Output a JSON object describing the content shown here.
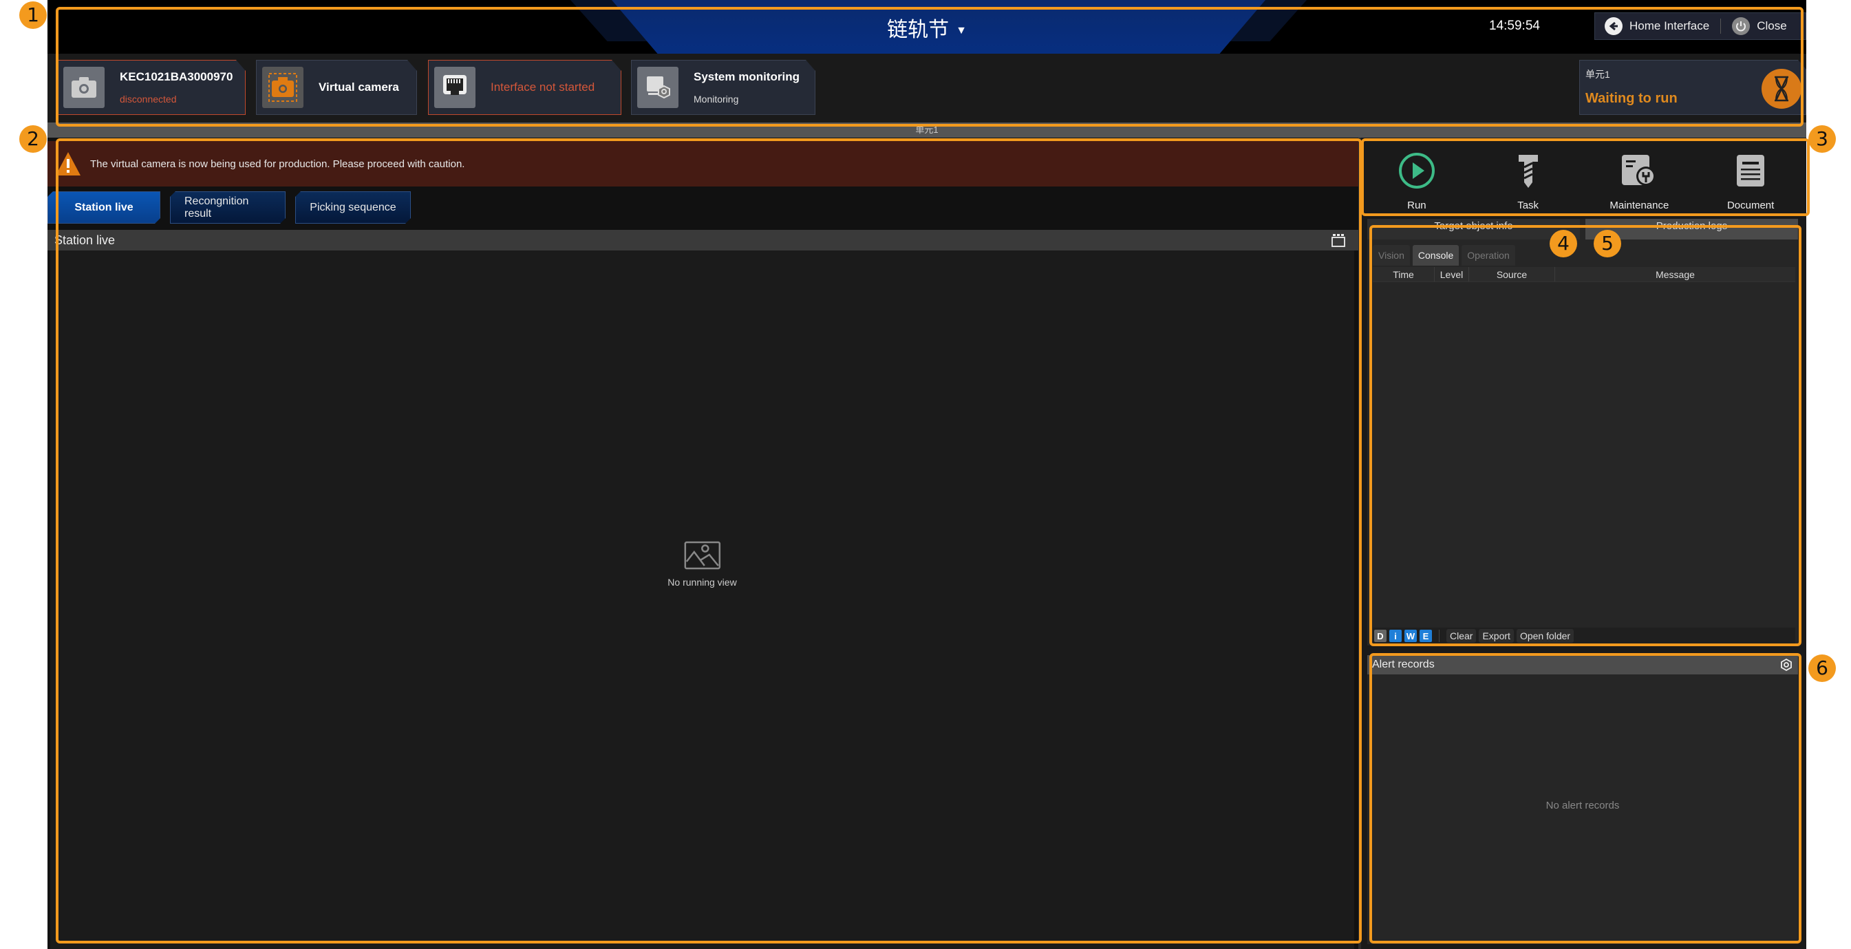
{
  "header": {
    "title": "链轨节",
    "clock": "14:59:54",
    "home_label": "Home Interface",
    "close_label": "Close"
  },
  "status_cards": [
    {
      "title": "KEC1021BA3000970",
      "subtitle": "disconnected",
      "icon": "camera-icon",
      "state": "error"
    },
    {
      "title": "Virtual camera",
      "subtitle": "",
      "icon": "virtual-camera-icon",
      "state": "normal"
    },
    {
      "title": "Interface not started",
      "subtitle": "",
      "icon": "ethernet-port-icon",
      "state": "error"
    },
    {
      "title": "System monitoring",
      "subtitle": "Monitoring",
      "icon": "system-monitor-icon",
      "state": "normal"
    }
  ],
  "unit": {
    "name": "单元1",
    "status": "Waiting to run",
    "status_color": "#e08a1e",
    "strip_label": "单元1"
  },
  "warning": {
    "message": "The virtual camera is now being used for production. Please proceed with caution."
  },
  "view_tabs": [
    {
      "label": "Station live",
      "active": true
    },
    {
      "label": "Recongnition result",
      "active": false
    },
    {
      "label": "Picking sequence",
      "active": false
    }
  ],
  "station_live": {
    "header": "Station live",
    "empty_text": "No running view"
  },
  "toolbar": [
    {
      "label": "Run",
      "icon": "play-icon"
    },
    {
      "label": "Task",
      "icon": "screw-icon"
    },
    {
      "label": "Maintenance",
      "icon": "maintenance-icon"
    },
    {
      "label": "Document",
      "icon": "document-icon"
    }
  ],
  "log_panel": {
    "tabs": [
      {
        "label": "Target object info",
        "selected": false
      },
      {
        "label": "Production logs",
        "selected": true
      }
    ],
    "sub_tabs": [
      {
        "label": "Vision",
        "selected": false
      },
      {
        "label": "Console",
        "selected": true
      },
      {
        "label": "Operation",
        "selected": false
      }
    ],
    "columns": [
      "Time",
      "Level",
      "Source",
      "Message"
    ],
    "rows": [],
    "level_filters": [
      "D",
      "i",
      "W",
      "E"
    ],
    "actions": [
      "Clear",
      "Export",
      "Open folder"
    ]
  },
  "alerts": {
    "title": "Alert records",
    "empty_text": "No alert records"
  },
  "annotations": [
    "1",
    "2",
    "3",
    "4",
    "5",
    "6"
  ],
  "colors": {
    "accent": "#f39a1e",
    "error": "#d4573a",
    "run_green": "#3dbb87",
    "tab_active": "#0a56b4"
  }
}
